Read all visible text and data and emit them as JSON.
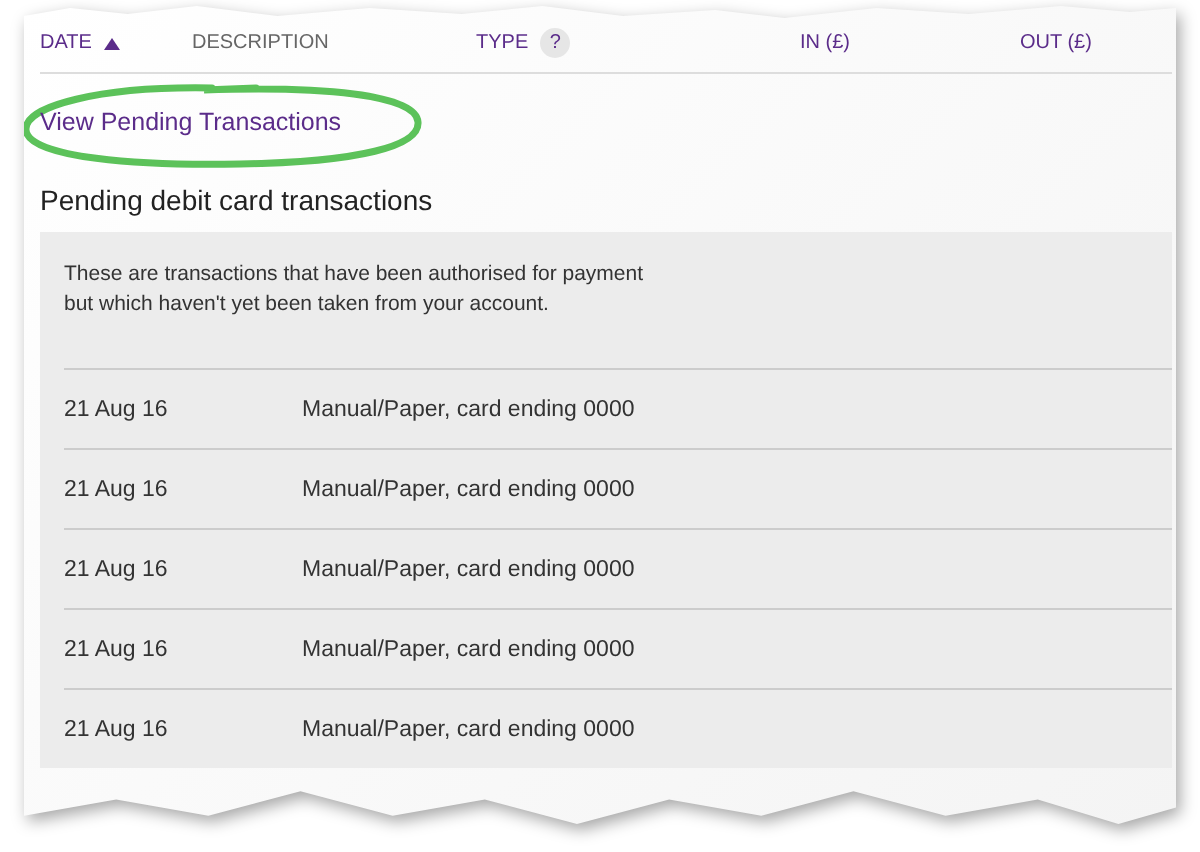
{
  "table": {
    "columns": [
      {
        "label": "DATE",
        "sortable": true,
        "sorted": true
      },
      {
        "label": "DESCRIPTION",
        "sortable": false,
        "sorted": false
      },
      {
        "label": "TYPE",
        "sortable": true,
        "sorted": false,
        "help": "?"
      },
      {
        "label": "IN (£)",
        "sortable": true,
        "sorted": false
      },
      {
        "label": "OUT (£)",
        "sortable": true,
        "sorted": false
      }
    ]
  },
  "pending_link": {
    "label": "View Pending Transactions",
    "highlighted": true
  },
  "pending": {
    "title": "Pending debit card transactions",
    "note": "These are transactions that have been authorised for payment\nbut which haven't yet been taken from your account.",
    "rows": [
      {
        "date": "21 Aug 16",
        "description": "Manual/Paper, card ending 0000"
      },
      {
        "date": "21 Aug 16",
        "description": "Manual/Paper, card ending 0000"
      },
      {
        "date": "21 Aug 16",
        "description": "Manual/Paper, card ending 0000"
      },
      {
        "date": "21 Aug 16",
        "description": "Manual/Paper, card ending 0000"
      },
      {
        "date": "21 Aug 16",
        "description": "Manual/Paper, card ending 0000"
      }
    ]
  }
}
